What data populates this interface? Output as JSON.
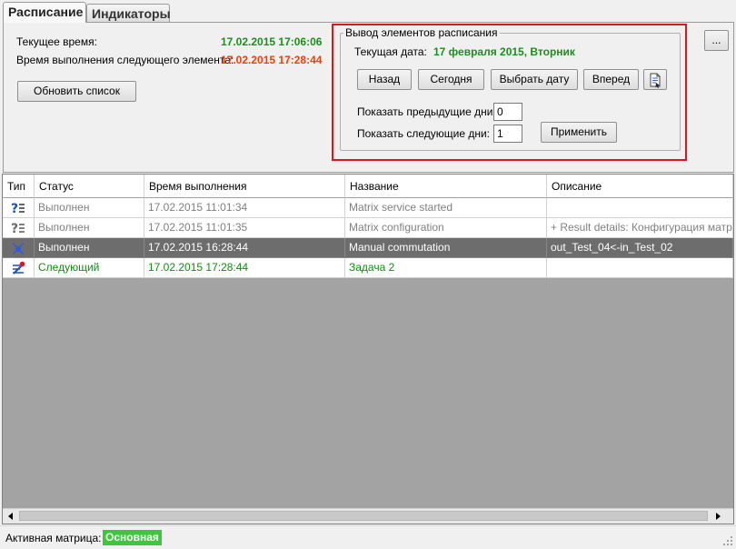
{
  "tabs": [
    {
      "label": "Расписание"
    },
    {
      "label": "Индикаторы"
    }
  ],
  "info": {
    "current_time_label": "Текущее время:",
    "current_time_value": "17.02.2015 17:06:06",
    "next_elem_label": "Время выполнения следующего элемента:",
    "next_elem_value": "17.02.2015 17:28:44",
    "refresh_label": "Обновить список",
    "more_label": "..."
  },
  "schedule_output": {
    "legend": "Вывод элементов расписания",
    "current_date_label": "Текущая дата:",
    "current_date_value": "17 февраля 2015, Вторник",
    "back_label": "Назад",
    "today_label": "Сегодня",
    "pick_date_label": "Выбрать дату",
    "forward_label": "Вперед",
    "prev_days_label": "Показать предыдущие дни:",
    "prev_days_value": "0",
    "next_days_label": "Показать следующие дни:",
    "next_days_value": "1",
    "apply_label": "Применить"
  },
  "grid": {
    "columns": [
      "Тип",
      "Статус",
      "Время выполнения",
      "Название",
      "Описание"
    ],
    "rows": [
      {
        "type_icon": "question-list-icon",
        "status": "Выполнен",
        "time": "17.02.2015 11:01:34",
        "name": "Matrix service started",
        "description": ""
      },
      {
        "type_icon": "question-list-icon",
        "status": "Выполнен",
        "time": "17.02.2015 11:01:35",
        "name": "Matrix configuration",
        "description": "+ Result details: Конфигурация матрицы"
      },
      {
        "type_icon": "commutation-icon",
        "status": "Выполнен",
        "time": "17.02.2015 16:28:44",
        "name": "Manual commutation",
        "description": "out_Test_04<-in_Test_02"
      },
      {
        "type_icon": "next-task-icon",
        "status": "Следующий",
        "time": "17.02.2015 17:28:44",
        "name": "Задача 2",
        "description": ""
      }
    ]
  },
  "status_bar": {
    "active_matrix_label": "Активная матрица:",
    "active_matrix_value": "Основная"
  },
  "colors": {
    "done_text": "#808080",
    "next_text": "#118a11",
    "selected_row": "#6d6d6d",
    "highlight_frame": "#e0141e",
    "badge": "#3fc63f"
  }
}
